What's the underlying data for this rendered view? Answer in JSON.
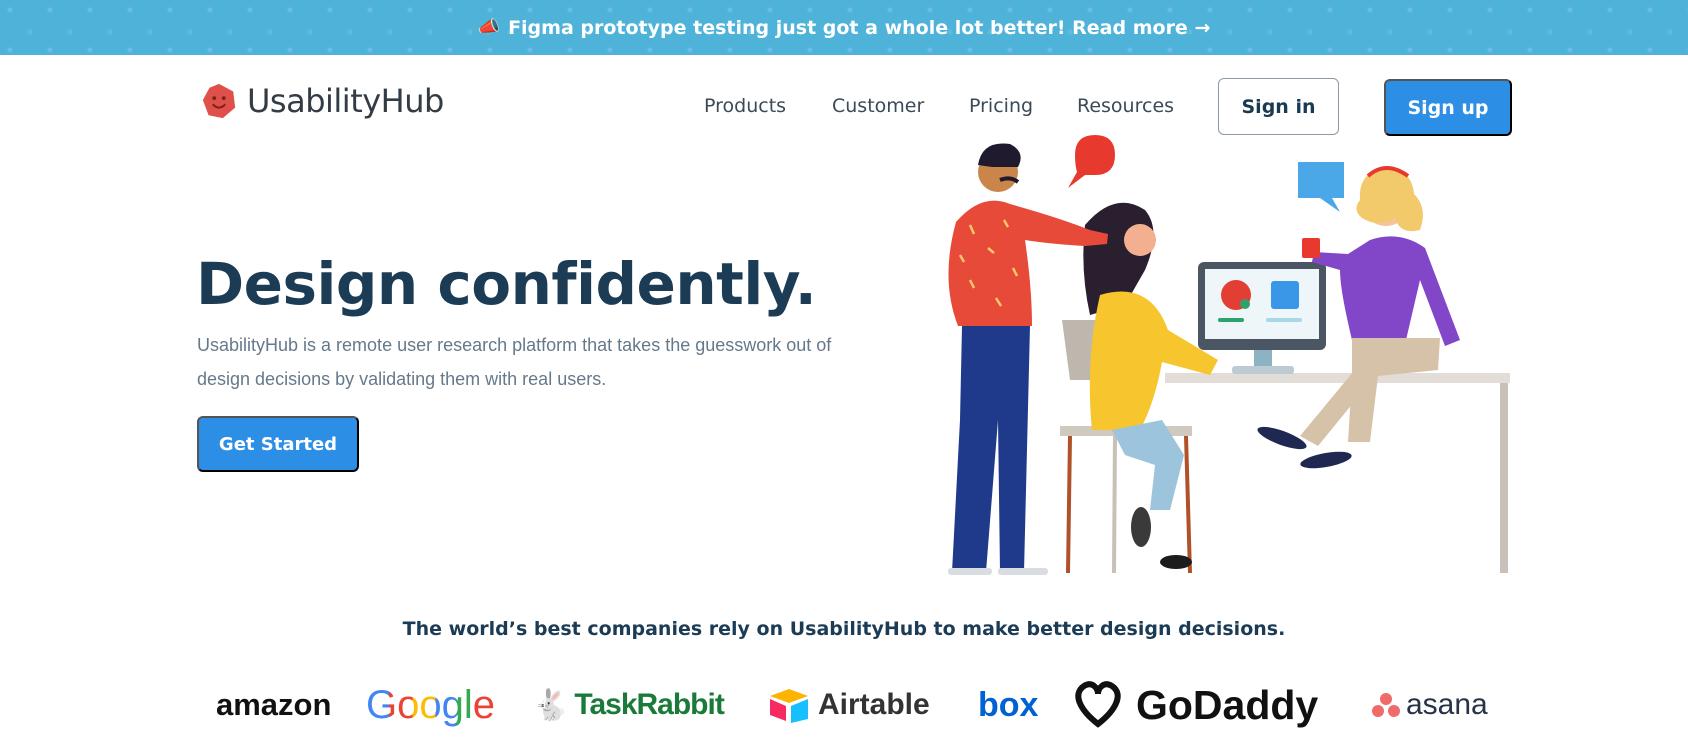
{
  "banner": {
    "icon": "megaphone-icon",
    "emoji": "📣",
    "text": "Figma prototype testing just got a whole lot better! Read more →",
    "bg_color": "#4fb3d9"
  },
  "brand": {
    "name": "UsabilityHub",
    "logo_icon": "hexagon-face-logo",
    "logo_color": "#e0504a"
  },
  "nav": {
    "items": [
      {
        "label": "Products"
      },
      {
        "label": "Customer"
      },
      {
        "label": "Pricing"
      },
      {
        "label": "Resources"
      }
    ],
    "signin_label": "Sign in",
    "signup_label": "Sign up"
  },
  "hero": {
    "title": "Design confidently.",
    "description": "UsabilityHub is a remote user research platform that takes the guesswork out of design decisions by validating them with real users.",
    "cta_label": "Get Started",
    "illustration": "team-collaboration-illustration"
  },
  "trust": {
    "text": "The world’s best companies rely on UsabilityHub to make better design decisions.",
    "logos": [
      {
        "name": "amazon"
      },
      {
        "name": "Google"
      },
      {
        "name": "TaskRabbit"
      },
      {
        "name": "Airtable"
      },
      {
        "name": "box"
      },
      {
        "name": "GoDaddy"
      },
      {
        "name": "asana"
      }
    ]
  },
  "colors": {
    "primary": "#2d8ee6",
    "heading": "#1c3c56",
    "body_text": "#66798a"
  }
}
